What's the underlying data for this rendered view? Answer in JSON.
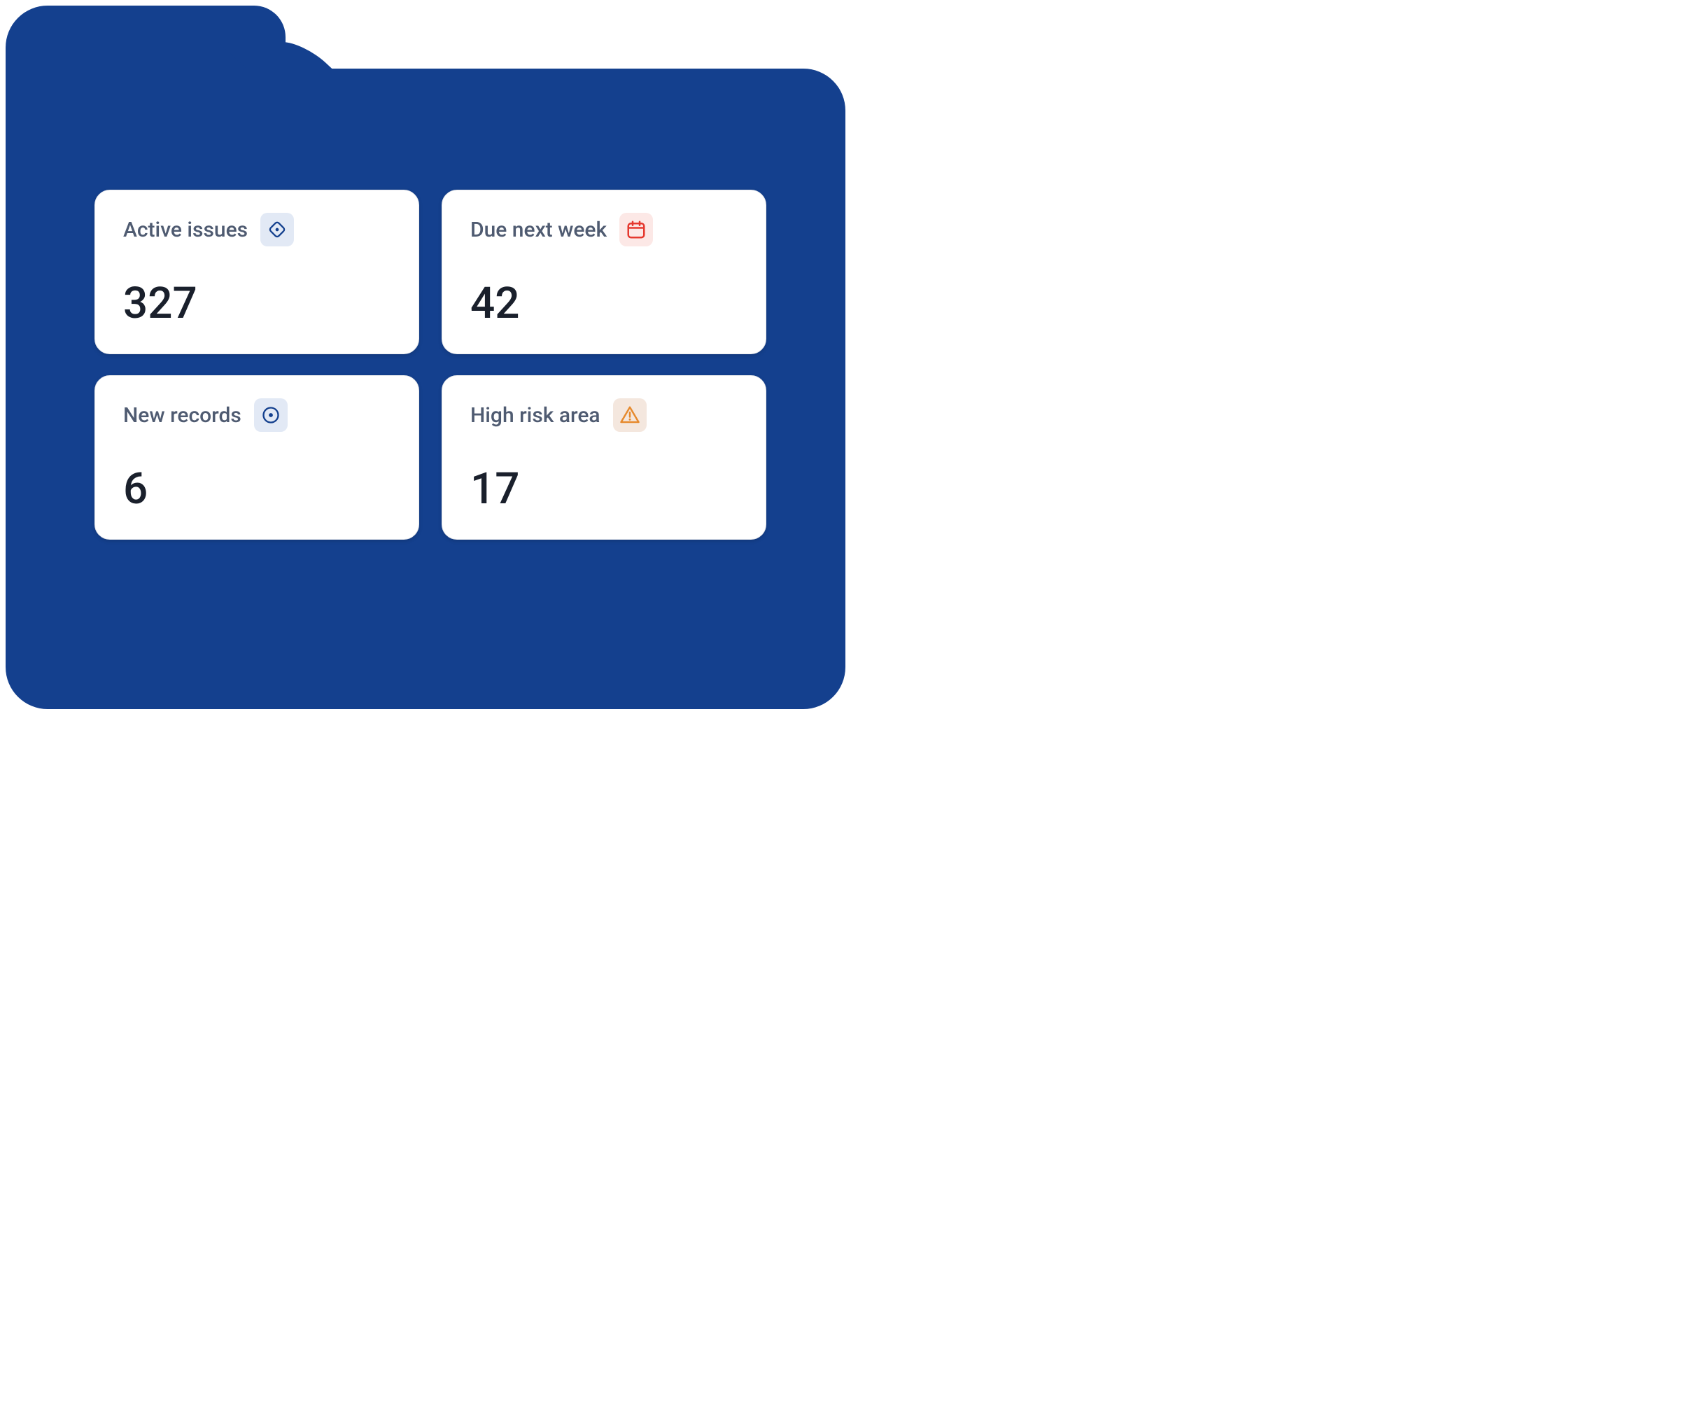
{
  "cards": [
    {
      "label": "Active issues",
      "value": "327",
      "icon": "diamond-dot",
      "badge_class": "blue-light",
      "icon_color": "#14408e"
    },
    {
      "label": "Due next week",
      "value": "42",
      "icon": "calendar",
      "badge_class": "red-light",
      "icon_color": "#e5382e"
    },
    {
      "label": "New records",
      "value": "6",
      "icon": "circle-dot",
      "badge_class": "blue-light",
      "icon_color": "#14408e"
    },
    {
      "label": "High risk area",
      "value": "17",
      "icon": "warning-triangle",
      "badge_class": "orange-light",
      "icon_color": "#e68a2e"
    }
  ]
}
